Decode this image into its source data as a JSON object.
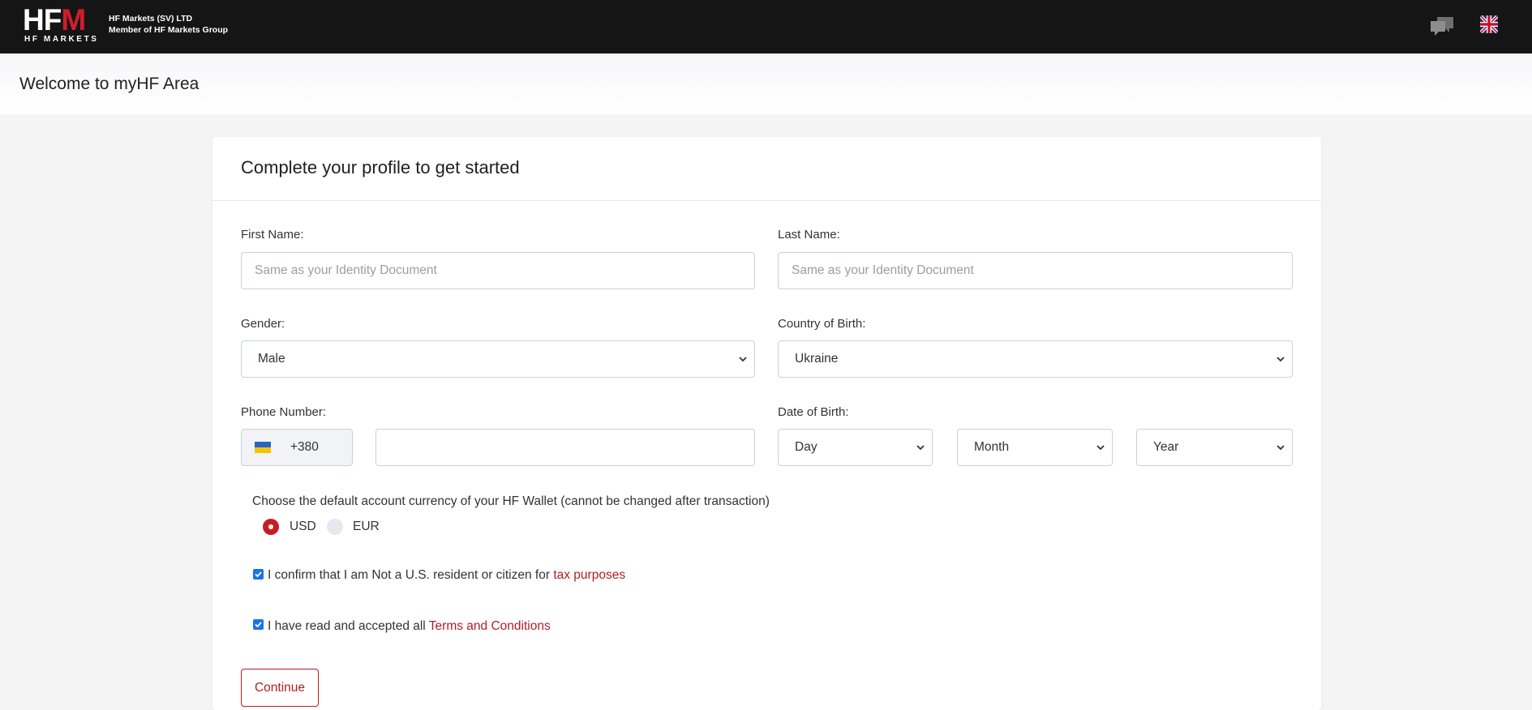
{
  "header": {
    "logo_text": "HFM",
    "logo_sub": "HF MARKETS",
    "company_line1": "HF Markets (SV) LTD",
    "company_line2": "Member of HF Markets Group",
    "chat_icon": "chat-icon",
    "language_icon": "uk-flag-icon"
  },
  "welcome": {
    "title": "Welcome to myHF Area"
  },
  "form": {
    "title": "Complete your profile to get started",
    "first_name": {
      "label": "First Name:",
      "placeholder": "Same as your Identity Document",
      "value": ""
    },
    "last_name": {
      "label": "Last Name:",
      "placeholder": "Same as your Identity Document",
      "value": ""
    },
    "gender": {
      "label": "Gender:",
      "value": "Male"
    },
    "country_of_birth": {
      "label": "Country of Birth:",
      "value": "Ukraine"
    },
    "phone": {
      "label": "Phone Number:",
      "country_code": "+380",
      "flag_icon": "ukraine-flag-icon",
      "value": ""
    },
    "dob": {
      "label": "Date of Birth:",
      "day": "Day",
      "month": "Month",
      "year": "Year"
    },
    "currency": {
      "label": "Choose the default account currency of your HF Wallet (cannot be changed after transaction)",
      "options": [
        "USD",
        "EUR"
      ],
      "selected": "USD"
    },
    "confirm_us": {
      "checked": true,
      "text": "I confirm that I am Not a U.S. resident or citizen for ",
      "link": "tax purposes"
    },
    "terms": {
      "checked": true,
      "text": "I have read and accepted all ",
      "link": "Terms and Conditions"
    },
    "continue_label": "Continue"
  },
  "colors": {
    "accent": "#b01e25",
    "topbar": "#151515",
    "checkbox": "#1a73e8"
  }
}
